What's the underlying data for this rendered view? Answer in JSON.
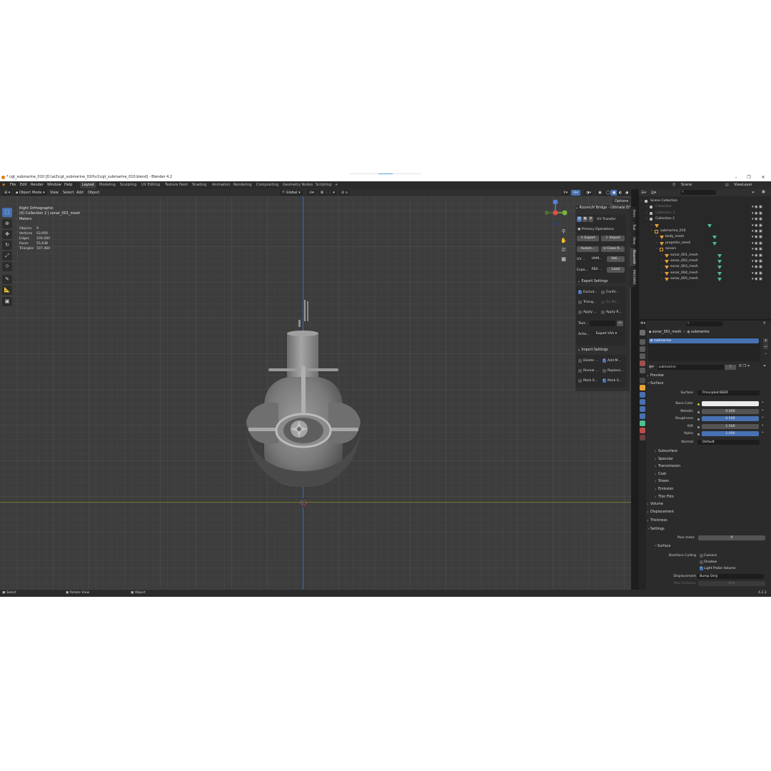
{
  "window": {
    "title": "* cgt_submarine_010 [D:\\ai2\\cgt_submarine_010\\v1\\cgt_submarine_010.blend] - Blender 4.2",
    "controls": [
      "–",
      "❐",
      "✕"
    ]
  },
  "menu": {
    "items": [
      "File",
      "Edit",
      "Render",
      "Window",
      "Help"
    ],
    "workspaces": [
      "Layout",
      "Modeling",
      "Sculpting",
      "UV Editing",
      "Texture Paint",
      "Shading",
      "Animation",
      "Rendering",
      "Compositing",
      "Geometry Nodes",
      "Scripting",
      "+"
    ],
    "active_workspace": "Layout",
    "scene_label": "Scene",
    "viewlayer_label": "ViewLayer"
  },
  "viewport_header": {
    "mode": "Object Mode",
    "menus": [
      "View",
      "Select",
      "Add",
      "Object"
    ],
    "orientation": "Global",
    "options_label": "Options"
  },
  "viewport": {
    "view_name": "Right Orthographic",
    "context": "(0) Collection 2 | sonar_001_mesh",
    "units": "Meters",
    "stats": [
      {
        "label": "Objects",
        "value": "9"
      },
      {
        "label": "Vertices",
        "value": "53,950"
      },
      {
        "label": "Edges",
        "value": "109,580"
      },
      {
        "label": "Faces",
        "value": "55,638"
      },
      {
        "label": "Triangles",
        "value": "107,484"
      }
    ]
  },
  "rizom_panel": {
    "title": "RizomUV Bridge - Ultimate Ed",
    "mode_label": "UV Transfer",
    "primary_ops": "Primary Operations:",
    "export_btn": "Export",
    "import_btn": "Import",
    "auto_btn": "Autom...",
    "close_btn": "Close R...",
    "uv_label": "UV ...",
    "uv_value": "UVM...",
    "vali_btn": "Vali...",
    "expo_label": "Expo...",
    "expo_value": "FBX ...",
    "load_btn": "Load",
    "export_settings": "Export Settings",
    "exclude": "Exclud...",
    "confirm": "Confir...",
    "triang": "Triang...",
    "fix_na": "Fix Na...",
    "apply_1": "Apply ...",
    "apply_r": "Apply R...",
    "text_label": "Text...",
    "action_label": "Actio...",
    "action_value": "Export UVs",
    "import_settings": "Import Settings",
    "delete": "Delete ...",
    "add_m": "Add M...",
    "reveal": "Reveal ...",
    "replace": "Replace...",
    "mark_s1": "Mark S...",
    "mark_s2": "Mark S..."
  },
  "side_tabs": [
    "Item",
    "Tool",
    "View",
    "RizomUV",
    "MACHIN3"
  ],
  "outliner": {
    "search_placeholder": "",
    "rows": [
      {
        "label": "Scene Collection",
        "indent": 0,
        "icon": "coll",
        "dim": false
      },
      {
        "label": "Collection",
        "indent": 1,
        "icon": "coll",
        "dim": true
      },
      {
        "label": "Collection 3",
        "indent": 1,
        "icon": "coll",
        "dim": true
      },
      {
        "label": "Collection 2",
        "indent": 1,
        "icon": "coll",
        "dim": false
      },
      {
        "label": "",
        "indent": 2,
        "icon": "tri",
        "dim": true
      },
      {
        "label": "submarine_010",
        "indent": 2,
        "icon": "empty",
        "dim": false
      },
      {
        "label": "body_mesh",
        "indent": 3,
        "icon": "tri",
        "dim": false
      },
      {
        "label": "propeller_mesh",
        "indent": 3,
        "icon": "tri",
        "dim": false
      },
      {
        "label": "sonars",
        "indent": 3,
        "icon": "empty",
        "dim": false
      },
      {
        "label": "sonar_001_mesh",
        "indent": 4,
        "icon": "tri",
        "dim": false
      },
      {
        "label": "sonar_002_mesh",
        "indent": 4,
        "icon": "tri",
        "dim": false
      },
      {
        "label": "sonar_003_mesh",
        "indent": 4,
        "icon": "tri",
        "dim": false
      },
      {
        "label": "sonar_004_mesh",
        "indent": 4,
        "icon": "tri",
        "dim": false
      },
      {
        "label": "sonar_005_mesh",
        "indent": 4,
        "icon": "tri",
        "dim": false
      }
    ]
  },
  "properties": {
    "search_placeholder": "",
    "breadcrumb_object": "sonar_001_mesh",
    "breadcrumb_material": "submarine",
    "slot_name": "submarine",
    "material_name": "submarine",
    "users": "7",
    "preview_label": "Preview",
    "surface_label": "Surface",
    "surface_shader_label": "Surface",
    "surface_shader": "Principled BSDF",
    "fields": [
      {
        "label": "Base Color",
        "value": "",
        "kind": "white",
        "sock": "yellow"
      },
      {
        "label": "Metallic",
        "value": "0.000",
        "kind": "grey",
        "sock": "grey"
      },
      {
        "label": "Roughness",
        "value": "0.500",
        "kind": "blue",
        "sock": "grey"
      },
      {
        "label": "IOR",
        "value": "1.500",
        "kind": "grey",
        "sock": "grey"
      },
      {
        "label": "Alpha",
        "value": "1.000",
        "kind": "blue",
        "sock": "grey"
      }
    ],
    "normal_label": "Normal",
    "normal_value": "Default",
    "subsections": [
      "Subsurface",
      "Specular",
      "Transmission",
      "Coat",
      "Sheen",
      "Emission",
      "Thin Film"
    ],
    "volume": "Volume",
    "displacement": "Displacement",
    "thickness": "Thickness",
    "settings": "Settings",
    "pass_index_label": "Pass Index",
    "pass_index_value": "0",
    "settings_surface": "Surface",
    "backface_label": "Backface Culling",
    "camera_label": "Camera",
    "shadow_label": "Shadow",
    "light_probe_label": "Light Probe Volume",
    "displacement_label": "Displacement",
    "displacement_value": "Bump Only",
    "max_distance_label": "Max Distance",
    "max_distance_value": "0 m"
  },
  "statusbar": {
    "select": "Select",
    "rotate": "Rotate View",
    "object": "Object",
    "version": "4.2.3"
  },
  "colors": {
    "accent": "#4772b3",
    "panel": "#2b2b2b",
    "viewport": "#3d3d3d",
    "object_orange": "#e8a33a",
    "mesh_green": "#4fbf8f"
  }
}
